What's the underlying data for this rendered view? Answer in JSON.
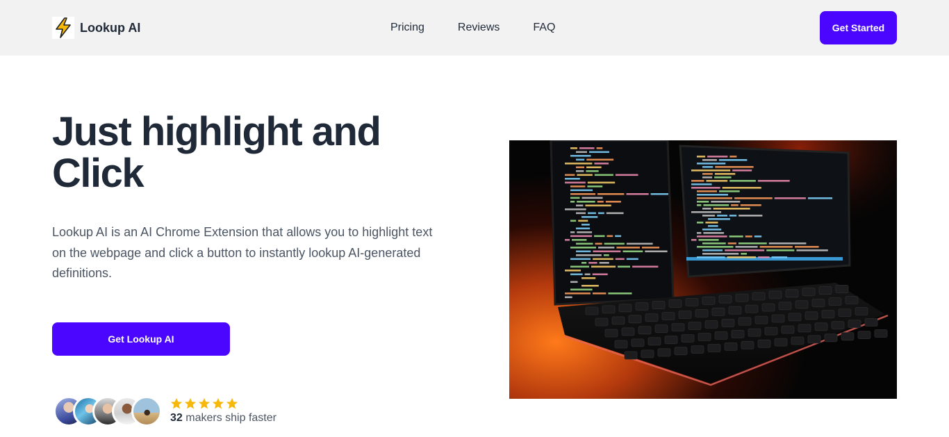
{
  "header": {
    "brand_name": "Lookup AI",
    "logo_icon": "lightning-bolt-icon",
    "nav": [
      {
        "label": "Pricing"
      },
      {
        "label": "Reviews"
      },
      {
        "label": "FAQ"
      }
    ],
    "cta_label": "Get Started"
  },
  "hero": {
    "title_line1": "Just highlight and",
    "title_line2": "Click",
    "description": "Lookup AI is an AI Chrome Extension that allows you to highlight text on the webpage and click a button to instantly lookup AI-generated definitions.",
    "cta_label": "Get Lookup AI",
    "image_description": "laptop-code-photo"
  },
  "social_proof": {
    "stars": 5,
    "count": "32",
    "text": "makers ship faster"
  },
  "colors": {
    "accent": "#4a06ff",
    "header_bg": "#f2f2f2",
    "star": "#f5b80b",
    "heading": "#1f2937"
  }
}
